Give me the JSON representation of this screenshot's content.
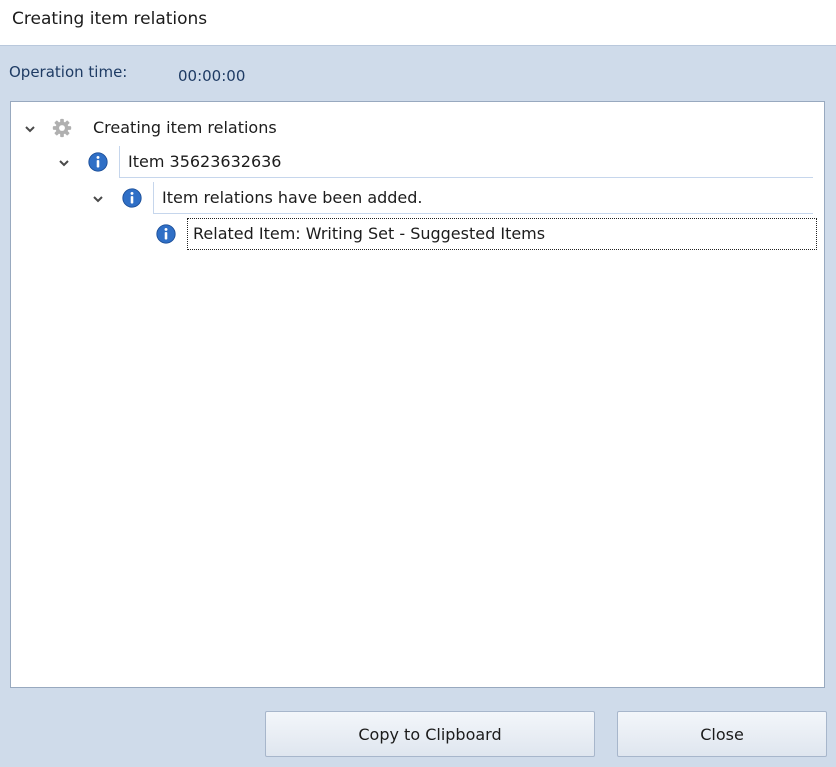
{
  "window": {
    "title": "Creating item relations"
  },
  "operation": {
    "label": "Operation time:",
    "value": "00:00:00"
  },
  "tree": [
    {
      "label": "Creating item relations",
      "icon": "gear-icon",
      "expanded": true
    },
    {
      "label": "Item 35623632636",
      "icon": "info-icon",
      "expanded": true
    },
    {
      "label": "Item relations have been added.",
      "icon": "info-icon",
      "expanded": true
    },
    {
      "label": "Related Item: Writing Set - Suggested Items",
      "icon": "info-icon",
      "focused": true
    }
  ],
  "buttons": {
    "copy": "Copy to Clipboard",
    "close": "Close"
  },
  "colors": {
    "background": "#cfdbea",
    "info_icon": "#2f6fc6",
    "text_blue": "#1e3b64"
  }
}
